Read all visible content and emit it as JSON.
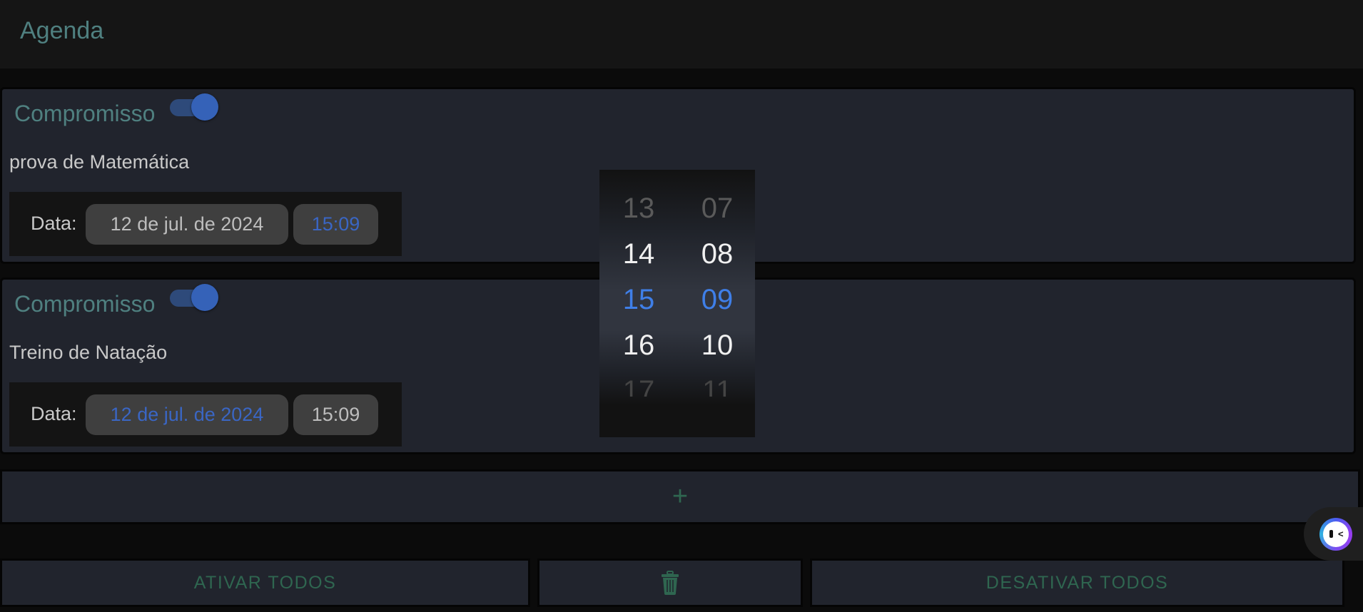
{
  "header": {
    "title": "Agenda"
  },
  "appointments": [
    {
      "label": "Compromisso",
      "enabled": true,
      "title": "prova de Matemática",
      "date_label": "Data:",
      "date": "12 de jul. de 2024",
      "time": "15:09"
    },
    {
      "label": "Compromisso",
      "enabled": true,
      "title": "Treino de Natação",
      "date_label": "Data:",
      "date": "12 de jul. de 2024",
      "time": "15:09"
    }
  ],
  "add_button": {
    "label": "+"
  },
  "actions": {
    "activate_all": "ATIVAR TODOS",
    "delete_icon": "trash-icon",
    "deactivate_all": "DESATIVAR TODOS"
  },
  "time_picker": {
    "hours": [
      "13",
      "14",
      "15",
      "16",
      "17"
    ],
    "minutes": [
      "07",
      "08",
      "09",
      "10",
      "11"
    ],
    "selected_hour": "15",
    "selected_minute": "09"
  },
  "colors": {
    "accent": "#3562b8",
    "selected": "#3f7fe8",
    "label": "#4f8080",
    "action": "#2f6650"
  }
}
